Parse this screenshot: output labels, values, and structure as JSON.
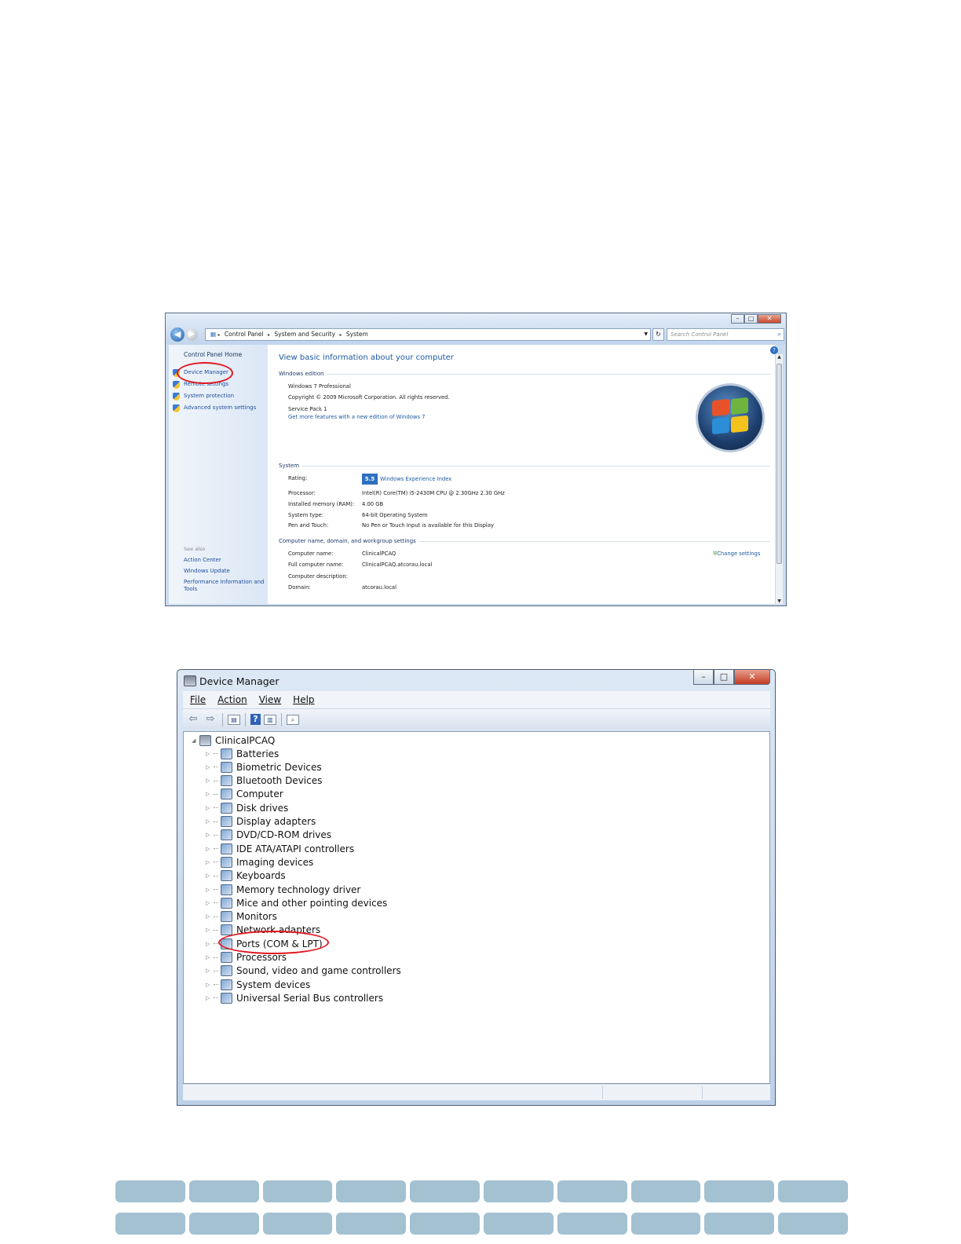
{
  "system_window": {
    "breadcrumb": [
      "Control Panel",
      "System and Security",
      "System"
    ],
    "search_placeholder": "Search Control Panel",
    "sidebar": {
      "home": "Control Panel Home",
      "tasks": [
        "Device Manager",
        "Remote settings",
        "System protection",
        "Advanced system settings"
      ],
      "see_also_label": "See also",
      "see_also": [
        "Action Center",
        "Windows Update",
        "Performance Information and Tools"
      ]
    },
    "heading": "View basic information about your computer",
    "windows_edition": {
      "label": "Windows edition",
      "edition": "Windows 7 Professional",
      "copyright": "Copyright © 2009 Microsoft Corporation.  All rights reserved.",
      "service_pack": "Service Pack 1",
      "more_features_link": "Get more features with a new edition of Windows 7"
    },
    "system": {
      "label": "System",
      "rating_label": "Rating:",
      "rating_score": "5.5",
      "rating_link": "Windows Experience Index",
      "processor_label": "Processor:",
      "processor": "Intel(R) Core(TM) i5-2430M CPU @ 2.30GHz   2.30 GHz",
      "memory_label": "Installed memory (RAM):",
      "memory": "4.00 GB",
      "type_label": "System type:",
      "type": "64-bit Operating System",
      "pen_label": "Pen and Touch:",
      "pen": "No Pen or Touch Input is available for this Display"
    },
    "computer_name": {
      "label": "Computer name, domain, and workgroup settings",
      "change_link": "Change settings",
      "name_label": "Computer name:",
      "name": "ClinicalPCAQ",
      "full_label": "Full computer name:",
      "full": "ClinicalPCAQ.atcorau.local",
      "desc_label": "Computer description:",
      "domain_label": "Domain:",
      "domain": "atcorau.local"
    }
  },
  "device_manager": {
    "title": "Device Manager",
    "menu": [
      "File",
      "Action",
      "View",
      "Help"
    ],
    "root": "ClinicalPCAQ",
    "categories": [
      "Batteries",
      "Biometric Devices",
      "Bluetooth Devices",
      "Computer",
      "Disk drives",
      "Display adapters",
      "DVD/CD-ROM drives",
      "IDE ATA/ATAPI controllers",
      "Imaging devices",
      "Keyboards",
      "Memory technology driver",
      "Mice and other pointing devices",
      "Monitors",
      "Network adapters",
      "Ports (COM & LPT)",
      "Processors",
      "Sound, video and game controllers",
      "System devices",
      "Universal Serial Bus controllers"
    ]
  },
  "colors": {
    "highlight_oval": "#e0161f",
    "link_blue": "#1e5aa0",
    "tile_band": "#a3c1d1"
  }
}
